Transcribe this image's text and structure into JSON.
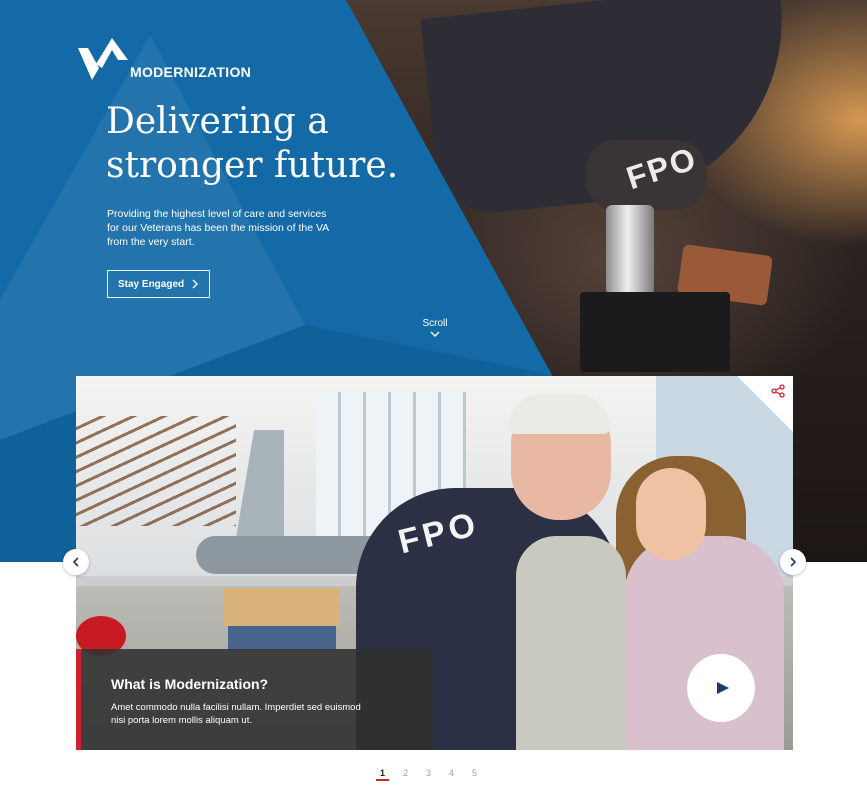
{
  "logo": {
    "text": "MODERNIZATION"
  },
  "hero": {
    "headline_line1": "Delivering a",
    "headline_line2": "stronger future.",
    "subtext": "Providing the highest level of care and services for our Veterans has been the mission of the VA from the very start.",
    "cta_label": "Stay Engaged",
    "scroll_label": "Scroll",
    "image_watermark": "FPO"
  },
  "carousel": {
    "image_watermark": "FPO",
    "caption_title": "What is Modernization?",
    "caption_text": "Amet commodo nulla facilisi nullam. Imperdiet sed euismod nisi porta lorem mollis aliquam ut.",
    "pages": [
      "1",
      "2",
      "3",
      "4",
      "5"
    ],
    "active_page": "1"
  },
  "colors": {
    "brand_blue": "#136aa6",
    "accent_red": "#d41f2c"
  },
  "icons": {
    "logo": "va-chevron-logo-icon",
    "cta": "chevron-right-icon",
    "scroll": "chevron-down-icon",
    "share": "share-icon",
    "play": "play-icon",
    "prev": "chevron-left-icon",
    "next": "chevron-right-icon"
  }
}
